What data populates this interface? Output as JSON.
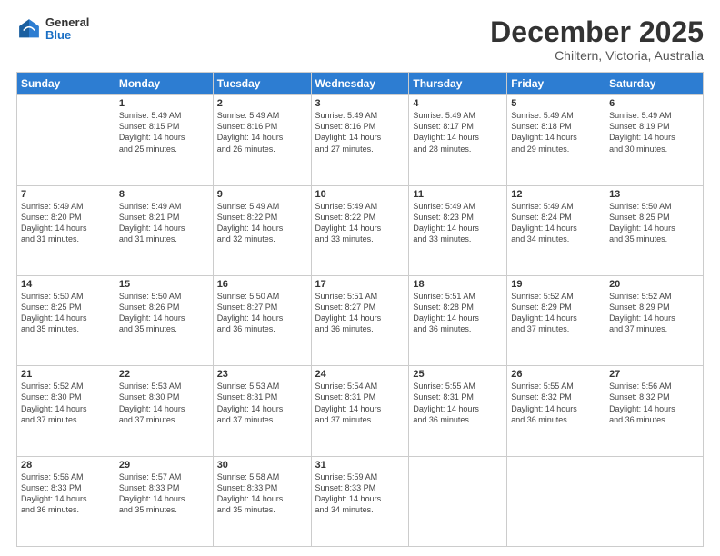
{
  "logo": {
    "general": "General",
    "blue": "Blue"
  },
  "title": {
    "month": "December 2025",
    "location": "Chiltern, Victoria, Australia"
  },
  "weekdays": [
    "Sunday",
    "Monday",
    "Tuesday",
    "Wednesday",
    "Thursday",
    "Friday",
    "Saturday"
  ],
  "weeks": [
    [
      {
        "day": "",
        "info": ""
      },
      {
        "day": "1",
        "info": "Sunrise: 5:49 AM\nSunset: 8:15 PM\nDaylight: 14 hours\nand 25 minutes."
      },
      {
        "day": "2",
        "info": "Sunrise: 5:49 AM\nSunset: 8:16 PM\nDaylight: 14 hours\nand 26 minutes."
      },
      {
        "day": "3",
        "info": "Sunrise: 5:49 AM\nSunset: 8:16 PM\nDaylight: 14 hours\nand 27 minutes."
      },
      {
        "day": "4",
        "info": "Sunrise: 5:49 AM\nSunset: 8:17 PM\nDaylight: 14 hours\nand 28 minutes."
      },
      {
        "day": "5",
        "info": "Sunrise: 5:49 AM\nSunset: 8:18 PM\nDaylight: 14 hours\nand 29 minutes."
      },
      {
        "day": "6",
        "info": "Sunrise: 5:49 AM\nSunset: 8:19 PM\nDaylight: 14 hours\nand 30 minutes."
      }
    ],
    [
      {
        "day": "7",
        "info": "Sunrise: 5:49 AM\nSunset: 8:20 PM\nDaylight: 14 hours\nand 31 minutes."
      },
      {
        "day": "8",
        "info": "Sunrise: 5:49 AM\nSunset: 8:21 PM\nDaylight: 14 hours\nand 31 minutes."
      },
      {
        "day": "9",
        "info": "Sunrise: 5:49 AM\nSunset: 8:22 PM\nDaylight: 14 hours\nand 32 minutes."
      },
      {
        "day": "10",
        "info": "Sunrise: 5:49 AM\nSunset: 8:22 PM\nDaylight: 14 hours\nand 33 minutes."
      },
      {
        "day": "11",
        "info": "Sunrise: 5:49 AM\nSunset: 8:23 PM\nDaylight: 14 hours\nand 33 minutes."
      },
      {
        "day": "12",
        "info": "Sunrise: 5:49 AM\nSunset: 8:24 PM\nDaylight: 14 hours\nand 34 minutes."
      },
      {
        "day": "13",
        "info": "Sunrise: 5:50 AM\nSunset: 8:25 PM\nDaylight: 14 hours\nand 35 minutes."
      }
    ],
    [
      {
        "day": "14",
        "info": "Sunrise: 5:50 AM\nSunset: 8:25 PM\nDaylight: 14 hours\nand 35 minutes."
      },
      {
        "day": "15",
        "info": "Sunrise: 5:50 AM\nSunset: 8:26 PM\nDaylight: 14 hours\nand 35 minutes."
      },
      {
        "day": "16",
        "info": "Sunrise: 5:50 AM\nSunset: 8:27 PM\nDaylight: 14 hours\nand 36 minutes."
      },
      {
        "day": "17",
        "info": "Sunrise: 5:51 AM\nSunset: 8:27 PM\nDaylight: 14 hours\nand 36 minutes."
      },
      {
        "day": "18",
        "info": "Sunrise: 5:51 AM\nSunset: 8:28 PM\nDaylight: 14 hours\nand 36 minutes."
      },
      {
        "day": "19",
        "info": "Sunrise: 5:52 AM\nSunset: 8:29 PM\nDaylight: 14 hours\nand 37 minutes."
      },
      {
        "day": "20",
        "info": "Sunrise: 5:52 AM\nSunset: 8:29 PM\nDaylight: 14 hours\nand 37 minutes."
      }
    ],
    [
      {
        "day": "21",
        "info": "Sunrise: 5:52 AM\nSunset: 8:30 PM\nDaylight: 14 hours\nand 37 minutes."
      },
      {
        "day": "22",
        "info": "Sunrise: 5:53 AM\nSunset: 8:30 PM\nDaylight: 14 hours\nand 37 minutes."
      },
      {
        "day": "23",
        "info": "Sunrise: 5:53 AM\nSunset: 8:31 PM\nDaylight: 14 hours\nand 37 minutes."
      },
      {
        "day": "24",
        "info": "Sunrise: 5:54 AM\nSunset: 8:31 PM\nDaylight: 14 hours\nand 37 minutes."
      },
      {
        "day": "25",
        "info": "Sunrise: 5:55 AM\nSunset: 8:31 PM\nDaylight: 14 hours\nand 36 minutes."
      },
      {
        "day": "26",
        "info": "Sunrise: 5:55 AM\nSunset: 8:32 PM\nDaylight: 14 hours\nand 36 minutes."
      },
      {
        "day": "27",
        "info": "Sunrise: 5:56 AM\nSunset: 8:32 PM\nDaylight: 14 hours\nand 36 minutes."
      }
    ],
    [
      {
        "day": "28",
        "info": "Sunrise: 5:56 AM\nSunset: 8:33 PM\nDaylight: 14 hours\nand 36 minutes."
      },
      {
        "day": "29",
        "info": "Sunrise: 5:57 AM\nSunset: 8:33 PM\nDaylight: 14 hours\nand 35 minutes."
      },
      {
        "day": "30",
        "info": "Sunrise: 5:58 AM\nSunset: 8:33 PM\nDaylight: 14 hours\nand 35 minutes."
      },
      {
        "day": "31",
        "info": "Sunrise: 5:59 AM\nSunset: 8:33 PM\nDaylight: 14 hours\nand 34 minutes."
      },
      {
        "day": "",
        "info": ""
      },
      {
        "day": "",
        "info": ""
      },
      {
        "day": "",
        "info": ""
      }
    ]
  ]
}
